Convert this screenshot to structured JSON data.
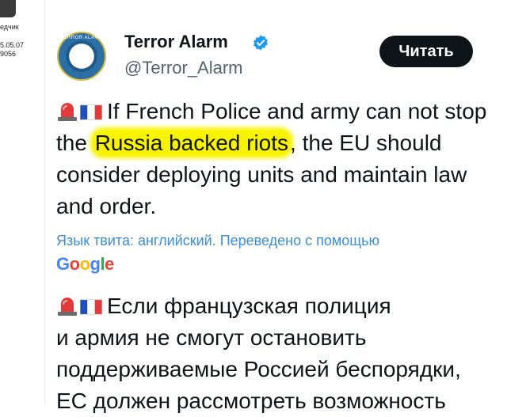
{
  "left_column": {
    "name_fragment": "едчик",
    "date_fragment": "5.05.07",
    "id_fragment": "9056"
  },
  "tweet": {
    "author_name": "Terror Alarm",
    "author_handle": "@Terror_Alarm",
    "avatar_text": "TERROR ALARM",
    "read_button_label": "Читать",
    "text_part1": "If French Police and army can not stop the ",
    "text_highlight": "Russia backed riots",
    "text_part2": ", the EU should consider deploying units and maintain law and order.",
    "translation_note": "Язык твита: английский. Переведено с помощью",
    "translation_provider": "Google",
    "translated_lines": [
      "Если французская полиция",
      "и армия не смогут остановить",
      "поддерживаемые Россией беспорядки,",
      "ЕС должен рассмотреть возможность"
    ]
  },
  "colors": {
    "highlight": "#f8f300",
    "link": "#3b8ed6",
    "verified": "#1d9bf0",
    "button_bg": "#0f1419"
  },
  "icons": [
    "siren-icon",
    "france-flag-icon",
    "verified-badge-icon"
  ]
}
